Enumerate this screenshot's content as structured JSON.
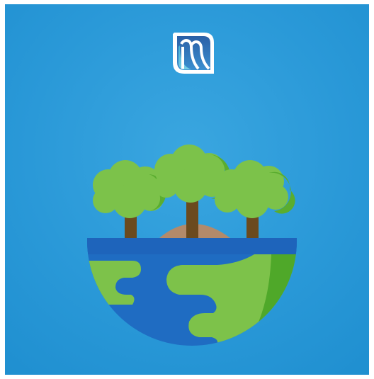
{
  "logo": {
    "icon": "waterfall-m-logo-icon"
  },
  "illustration": {
    "icon": "eco-earth-with-trees-icon",
    "colors": {
      "background": "#2a99d8",
      "ocean": "#1f6cc2",
      "land_light": "#7dc24a",
      "land_dark": "#4fa829",
      "tree_canopy_light": "#7cc24a",
      "tree_canopy_dark": "#5aad2f",
      "trunk": "#6b4a1e",
      "hill": "#b38a6a"
    }
  }
}
